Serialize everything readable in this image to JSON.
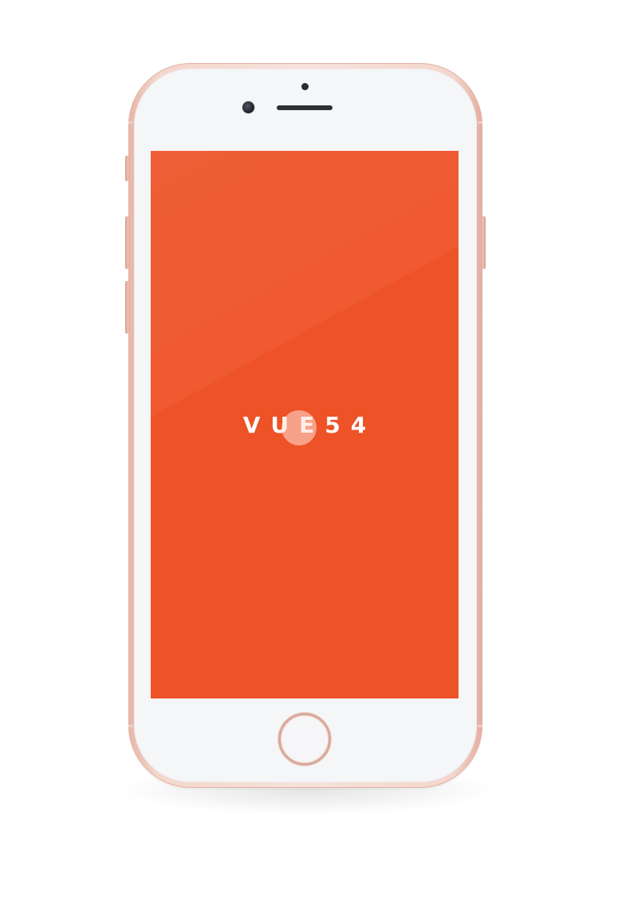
{
  "app": {
    "logo_text": "VUE54"
  },
  "device": {
    "model": "iphone",
    "finish": "rose-gold"
  },
  "icons": {
    "home_button": "home-button-icon",
    "camera": "front-camera-icon",
    "speaker": "earpiece-speaker-icon"
  },
  "colors": {
    "screen_background": "#ee5227",
    "logo_text": "#ffffff",
    "frame": "#f4d6cc",
    "face": "#f5f6f8"
  }
}
